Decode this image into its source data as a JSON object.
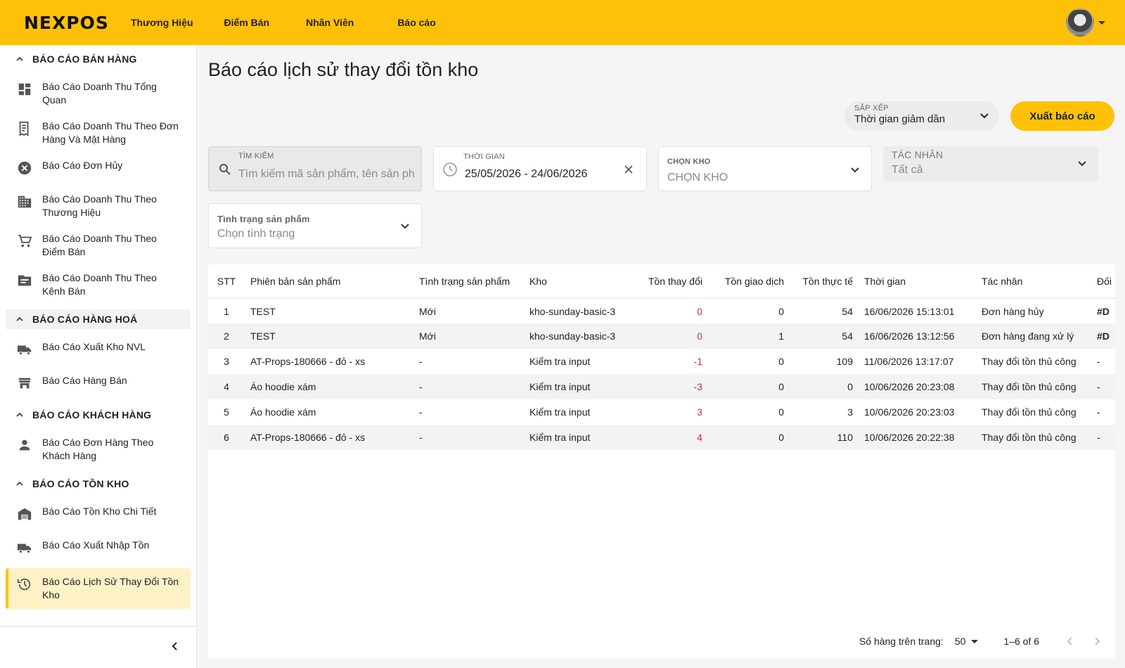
{
  "brand": {
    "logo": "NEXPOS",
    "accent": "#ffc107"
  },
  "topnav": [
    {
      "label": "Thương Hiệu"
    },
    {
      "label": "Điểm Bán"
    },
    {
      "label": "Nhân Viên"
    },
    {
      "label": "Báo cáo"
    }
  ],
  "sidebar": {
    "sections": [
      {
        "title": "BÁO CÁO BÁN HÀNG",
        "items": [
          {
            "label": "Báo Cáo Doanh Thu Tổng Quan",
            "icon": "dashboard-icon"
          },
          {
            "label": "Báo Cáo Doanh Thu Theo Đơn Hàng Và Mặt Hàng",
            "icon": "receipt-icon"
          },
          {
            "label": "Báo Cáo Đơn Hủy",
            "icon": "cancel-icon"
          },
          {
            "label": "Báo Cáo Doanh Thu Theo Thương Hiệu",
            "icon": "building-icon"
          },
          {
            "label": "Báo Cáo Doanh Thu Theo Điểm Bán",
            "icon": "cart-icon"
          },
          {
            "label": "Báo Cáo Doanh Thu Theo Kênh Bán",
            "icon": "folder-icon"
          }
        ]
      },
      {
        "title": "BÁO CÁO HÀNG HOÁ",
        "items": [
          {
            "label": "Báo Cáo Xuất Kho NVL",
            "icon": "truck-icon"
          },
          {
            "label": "Báo Cáo Hàng Bán",
            "icon": "store-icon"
          }
        ]
      },
      {
        "title": "BÁO CÁO KHÁCH HÀNG",
        "items": [
          {
            "label": "Báo Cáo Đơn Hàng Theo Khách Hàng",
            "icon": "person-icon"
          }
        ]
      },
      {
        "title": "BÁO CÁO TỒN KHO",
        "items": [
          {
            "label": "Báo Cáo Tồn Kho Chi Tiết",
            "icon": "warehouse-icon"
          },
          {
            "label": "Báo Cáo Xuất Nhập Tồn",
            "icon": "truck-icon"
          },
          {
            "label": "Báo Cáo Lịch Sử Thay Đổi Tồn Kho",
            "icon": "history-icon",
            "active": true
          }
        ]
      }
    ]
  },
  "page": {
    "title": "Báo cáo lịch sử thay đổi tồn kho"
  },
  "sort": {
    "caption": "SẮP XẾP",
    "value": "Thời gian giảm dần"
  },
  "export_label": "Xuất báo cáo",
  "filters": {
    "search": {
      "caption": "TÌM KIẾM",
      "placeholder": "Tìm kiếm mã sản phẩm, tên sản phẩm"
    },
    "time": {
      "caption": "THỜI GIAN",
      "value": "25/05/2026 - 24/06/2026"
    },
    "warehouse": {
      "caption": "CHỌN KHO",
      "placeholder": "CHỌN KHO"
    },
    "actor": {
      "caption": "TÁC NHÂN",
      "value": "Tất cả"
    },
    "status": {
      "caption": "Tình trạng sản phẩm",
      "placeholder": "Chọn tình trạng"
    }
  },
  "table": {
    "headers": [
      "STT",
      "Phiên bản sản phẩm",
      "Tình trạng sản phẩm",
      "Kho",
      "Tồn thay đổi",
      "Tồn giao dịch",
      "Tồn thực tế",
      "Thời gian",
      "Tác nhân",
      "Đối"
    ],
    "rows": [
      [
        "1",
        "TEST",
        "Mới",
        "kho-sunday-basic-3",
        "0",
        "0",
        "54",
        "16/06/2026 15:13:01",
        "Đơn hàng hủy",
        "#D"
      ],
      [
        "2",
        "TEST",
        "Mới",
        "kho-sunday-basic-3",
        "0",
        "1",
        "54",
        "16/06/2026 13:12:56",
        "Đơn hàng đang xử lý",
        "#D"
      ],
      [
        "3",
        "AT-Props-180666 - đỏ - xs",
        "-",
        "Kiểm tra input",
        "-1",
        "0",
        "109",
        "11/06/2026 13:17:07",
        "Thay đổi tồn thủ công",
        "-"
      ],
      [
        "4",
        "Áo hoodie xám",
        "-",
        "Kiểm tra input",
        "-3",
        "0",
        "0",
        "10/06/2026 20:23:08",
        "Thay đổi tồn thủ công",
        "-"
      ],
      [
        "5",
        "Áo hoodie xám",
        "-",
        "Kiểm tra input",
        "3",
        "0",
        "3",
        "10/06/2026 20:23:03",
        "Thay đổi tồn thủ công",
        "-"
      ],
      [
        "6",
        "AT-Props-180666 - đỏ - xs",
        "-",
        "Kiểm tra input",
        "4",
        "0",
        "110",
        "10/06/2026 20:22:38",
        "Thay đổi tồn thủ công",
        "-"
      ]
    ]
  },
  "pagination": {
    "rows_label": "Số hàng trên trang:",
    "rows_value": "50",
    "range": "1–6 of 6"
  }
}
